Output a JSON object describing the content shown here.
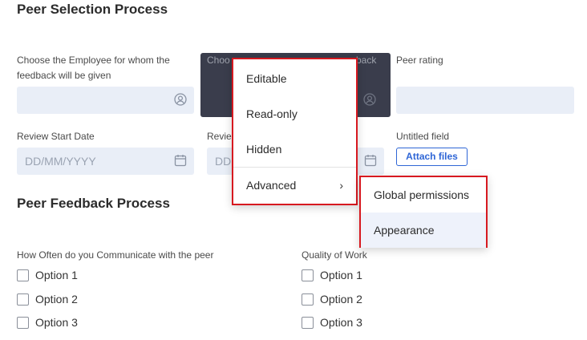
{
  "peer_selection": {
    "title": "Peer Selection Process",
    "employee_label": "Choose the Employee for whom the feedback will be given",
    "chooser_label_visible": "Choo",
    "chooser_label_tail": "back",
    "peer_rating_label": "Peer rating",
    "review_start_label": "Review Start Date",
    "review_end_label_visible": "Revie",
    "date_placeholder": "DD/MM/YYYY",
    "date_placeholder_partial": "DD",
    "untitled_label": "Untitled field",
    "attach_button": "Attach files"
  },
  "peer_feedback": {
    "title": "Peer Feedback Process",
    "q1_label": "How Often do you Communicate with the peer",
    "q1_options": [
      "Option 1",
      "Option 2",
      "Option 3"
    ],
    "q2_label": "Quality of Work",
    "q2_options": [
      "Option 1",
      "Option 2",
      "Option 3"
    ]
  },
  "context_menu": {
    "items": [
      "Editable",
      "Read-only",
      "Hidden"
    ],
    "advanced": "Advanced",
    "submenu": [
      "Global permissions",
      "Appearance"
    ]
  },
  "colors": {
    "accent": "#2f66d6",
    "highlight_border": "#d71920",
    "field_bg": "#e9eef7"
  }
}
